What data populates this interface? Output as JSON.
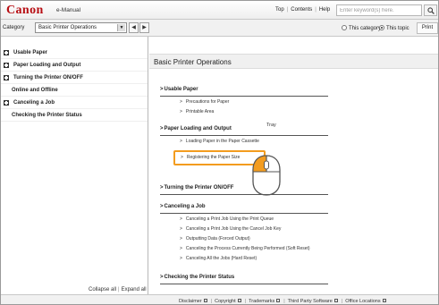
{
  "header": {
    "brand": "Canon",
    "product": "e-Manual",
    "top_link": "Top",
    "contents_link": "Contents",
    "help_link": "Help",
    "search_placeholder": "Enter keyword(s) here."
  },
  "category_bar": {
    "label": "Category",
    "selected": "Basic Printer Operations",
    "prev": "◀",
    "next": "▶",
    "this_category": "This category",
    "this_topic": "This topic",
    "selected_scope": "This topic",
    "print": "Print"
  },
  "sidebar": {
    "items": [
      {
        "label": "Usable Paper",
        "expandable": true
      },
      {
        "label": "Paper Loading and Output",
        "expandable": true
      },
      {
        "label": "Turning the Printer ON/OFF",
        "expandable": true
      },
      {
        "label": "Online and Offline",
        "expandable": false
      },
      {
        "label": "Canceling a Job",
        "expandable": true
      },
      {
        "label": "Checking the Printer Status",
        "expandable": false
      }
    ],
    "collapse_all": "Collapse all",
    "expand_all": "Expand all"
  },
  "main": {
    "title": "Basic Printer Operations",
    "sections": [
      {
        "title": "Usable Paper",
        "links": [
          "Precautions for Paper",
          "Printable Area"
        ]
      },
      {
        "title": "Paper Loading and Output",
        "links": [
          "Loading Paper in the Paper Cassette",
          "Registering the Paper Size"
        ]
      },
      {
        "title": "Turning the Printer ON/OFF",
        "links": []
      },
      {
        "title": "Canceling a Job",
        "links": [
          "Canceling a Print Job Using the Print Queue",
          "Canceling a Print Job Using the Cancel Job Key",
          "Outputting Data (Forced Output)",
          "Canceling the Process Currently Being Performed (Soft Reset)",
          "Canceling All the Jobs (Hard Reset)"
        ]
      },
      {
        "title": "Checking the Printer Status",
        "links": []
      }
    ],
    "tray_fragment": "Tray"
  },
  "footer": {
    "links": [
      "Disclaimer",
      "Copyright",
      "Trademarks",
      "Third Party Software",
      "Office Locations"
    ]
  },
  "colors": {
    "brand_red": "#b80f14",
    "highlight_orange": "#f39c1f"
  },
  "icons": {
    "search": "search-icon",
    "mouse": "mouse-left-click-icon"
  }
}
